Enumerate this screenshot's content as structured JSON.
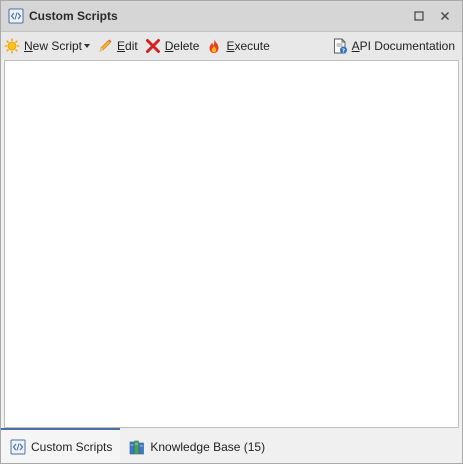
{
  "window": {
    "title": "Custom Scripts",
    "icon": "code-script-icon"
  },
  "toolbar": {
    "new_script": {
      "label": "New Script",
      "icon": "sun-new-icon"
    },
    "edit": {
      "label": "Edit",
      "icon": "pencil-icon"
    },
    "delete": {
      "label": "Delete",
      "icon": "red-x-icon"
    },
    "execute": {
      "label": "Execute",
      "icon": "flame-icon"
    },
    "api_docs": {
      "label": "API Documentation",
      "icon": "document-help-icon"
    }
  },
  "tabs": [
    {
      "label": "Custom Scripts",
      "icon": "code-script-icon",
      "active": true
    },
    {
      "label": "Knowledge Base (15)",
      "icon": "books-icon",
      "active": false
    }
  ],
  "colors": {
    "title_bar": "#d6d6d6",
    "toolbar": "#e8e8e8",
    "active_tab_accent": "#4a6fa5"
  }
}
